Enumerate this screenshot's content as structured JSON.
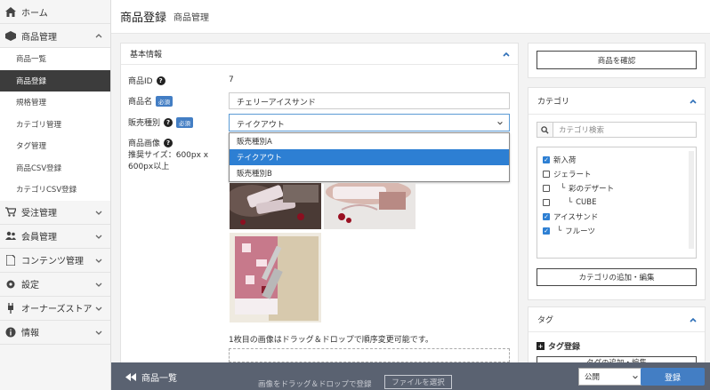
{
  "sidebar": {
    "home": "ホーム",
    "products": "商品管理",
    "product_subitems": [
      "商品一覧",
      "商品登録",
      "規格管理",
      "カテゴリ管理",
      "タグ管理",
      "商品CSV登録",
      "カテゴリCSV登録"
    ],
    "order": "受注管理",
    "customer": "会員管理",
    "content": "コンテンツ管理",
    "settings": "設定",
    "store": "オーナーズストア",
    "info": "情報"
  },
  "header": {
    "title": "商品登録",
    "subtitle": "商品管理"
  },
  "basic_info": {
    "title": "基本情報",
    "product_id_label": "商品ID",
    "product_id_value": "7",
    "product_name_label": "商品名",
    "required_badge": "必須",
    "product_name_value": "チェリーアイスサンド",
    "product_type_label": "販売種別",
    "product_type_value": "テイクアウト",
    "dropdown_options": [
      "販売種別A",
      "テイクアウト",
      "販売種別B"
    ],
    "product_image_label": "商品画像",
    "image_hint_line1": "推奨サイズ：600px x",
    "image_hint_line2": "600px以上",
    "drag_hint": "1枚目の画像はドラッグ＆ドロップで順序変更可能です。",
    "drop_text": "画像をドラッグ＆ドロップで登録",
    "file_select": "ファイルを選択"
  },
  "right": {
    "preview_button": "商品を確認",
    "category_title": "カテゴリ",
    "category_search_placeholder": "カテゴリ検索",
    "categories": [
      {
        "label": "新入荷",
        "checked": true,
        "indent": 0
      },
      {
        "label": "ジェラート",
        "checked": false,
        "indent": 0
      },
      {
        "label": "彩のデザート",
        "checked": false,
        "indent": 1
      },
      {
        "label": "CUBE",
        "checked": false,
        "indent": 2
      },
      {
        "label": "アイスサンド",
        "checked": true,
        "indent": 0
      },
      {
        "label": "フルーツ",
        "checked": true,
        "indent": 1
      }
    ],
    "category_manage_button": "カテゴリの追加・編集",
    "tag_title": "タグ",
    "tag_register": "タグ登録",
    "tag_manage_button": "タグの追加・編集"
  },
  "bottom": {
    "back_label": "商品一覧",
    "publish_value": "公開",
    "save_label": "登録"
  }
}
